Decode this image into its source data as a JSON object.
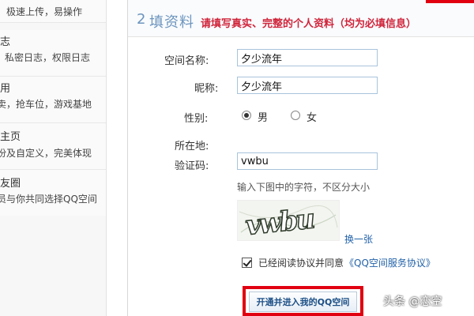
{
  "sidebar": {
    "items": [
      {
        "title": "",
        "desc": "，极速上传，易操作"
      },
      {
        "title": "志",
        "desc": "私密日志，权限日志"
      },
      {
        "title": "用",
        "desc": "卖，抢车位，游戏基地"
      },
      {
        "title": "主页",
        "desc": "份及自定义，完美体现"
      },
      {
        "title": "友圈",
        "desc": "员与你共同选择QQ空间"
      }
    ]
  },
  "header": {
    "step_number": "2",
    "step_title": "填资料",
    "step_note": "请填写真实、完整的个人资料（均为必填信息）"
  },
  "form": {
    "space_name_label": "空间名称:",
    "space_name_value": "夕少流年",
    "nickname_label": "昵称:",
    "nickname_value": "夕少流年",
    "gender_label": "性别:",
    "gender_male": "男",
    "gender_female": "女",
    "gender_selected": "男",
    "location_label": "所在地:",
    "captcha_label": "验证码:",
    "captcha_value": "vwbu",
    "captcha_hint": "输入下图中的字符，不区分大小",
    "captcha_image_text": "vwbu",
    "refresh_link": "换一张",
    "agreement_text": "已经阅读协议并同意",
    "agreement_link": "《QQ空间服务协议》",
    "submit_label": "开通并进入我的QQ空间"
  },
  "watermark": "头条 @恋空",
  "colors": {
    "accent_blue": "#6d95be",
    "required_red": "#d0243a",
    "highlight_red": "#e00010",
    "link_blue": "#2262a8"
  }
}
